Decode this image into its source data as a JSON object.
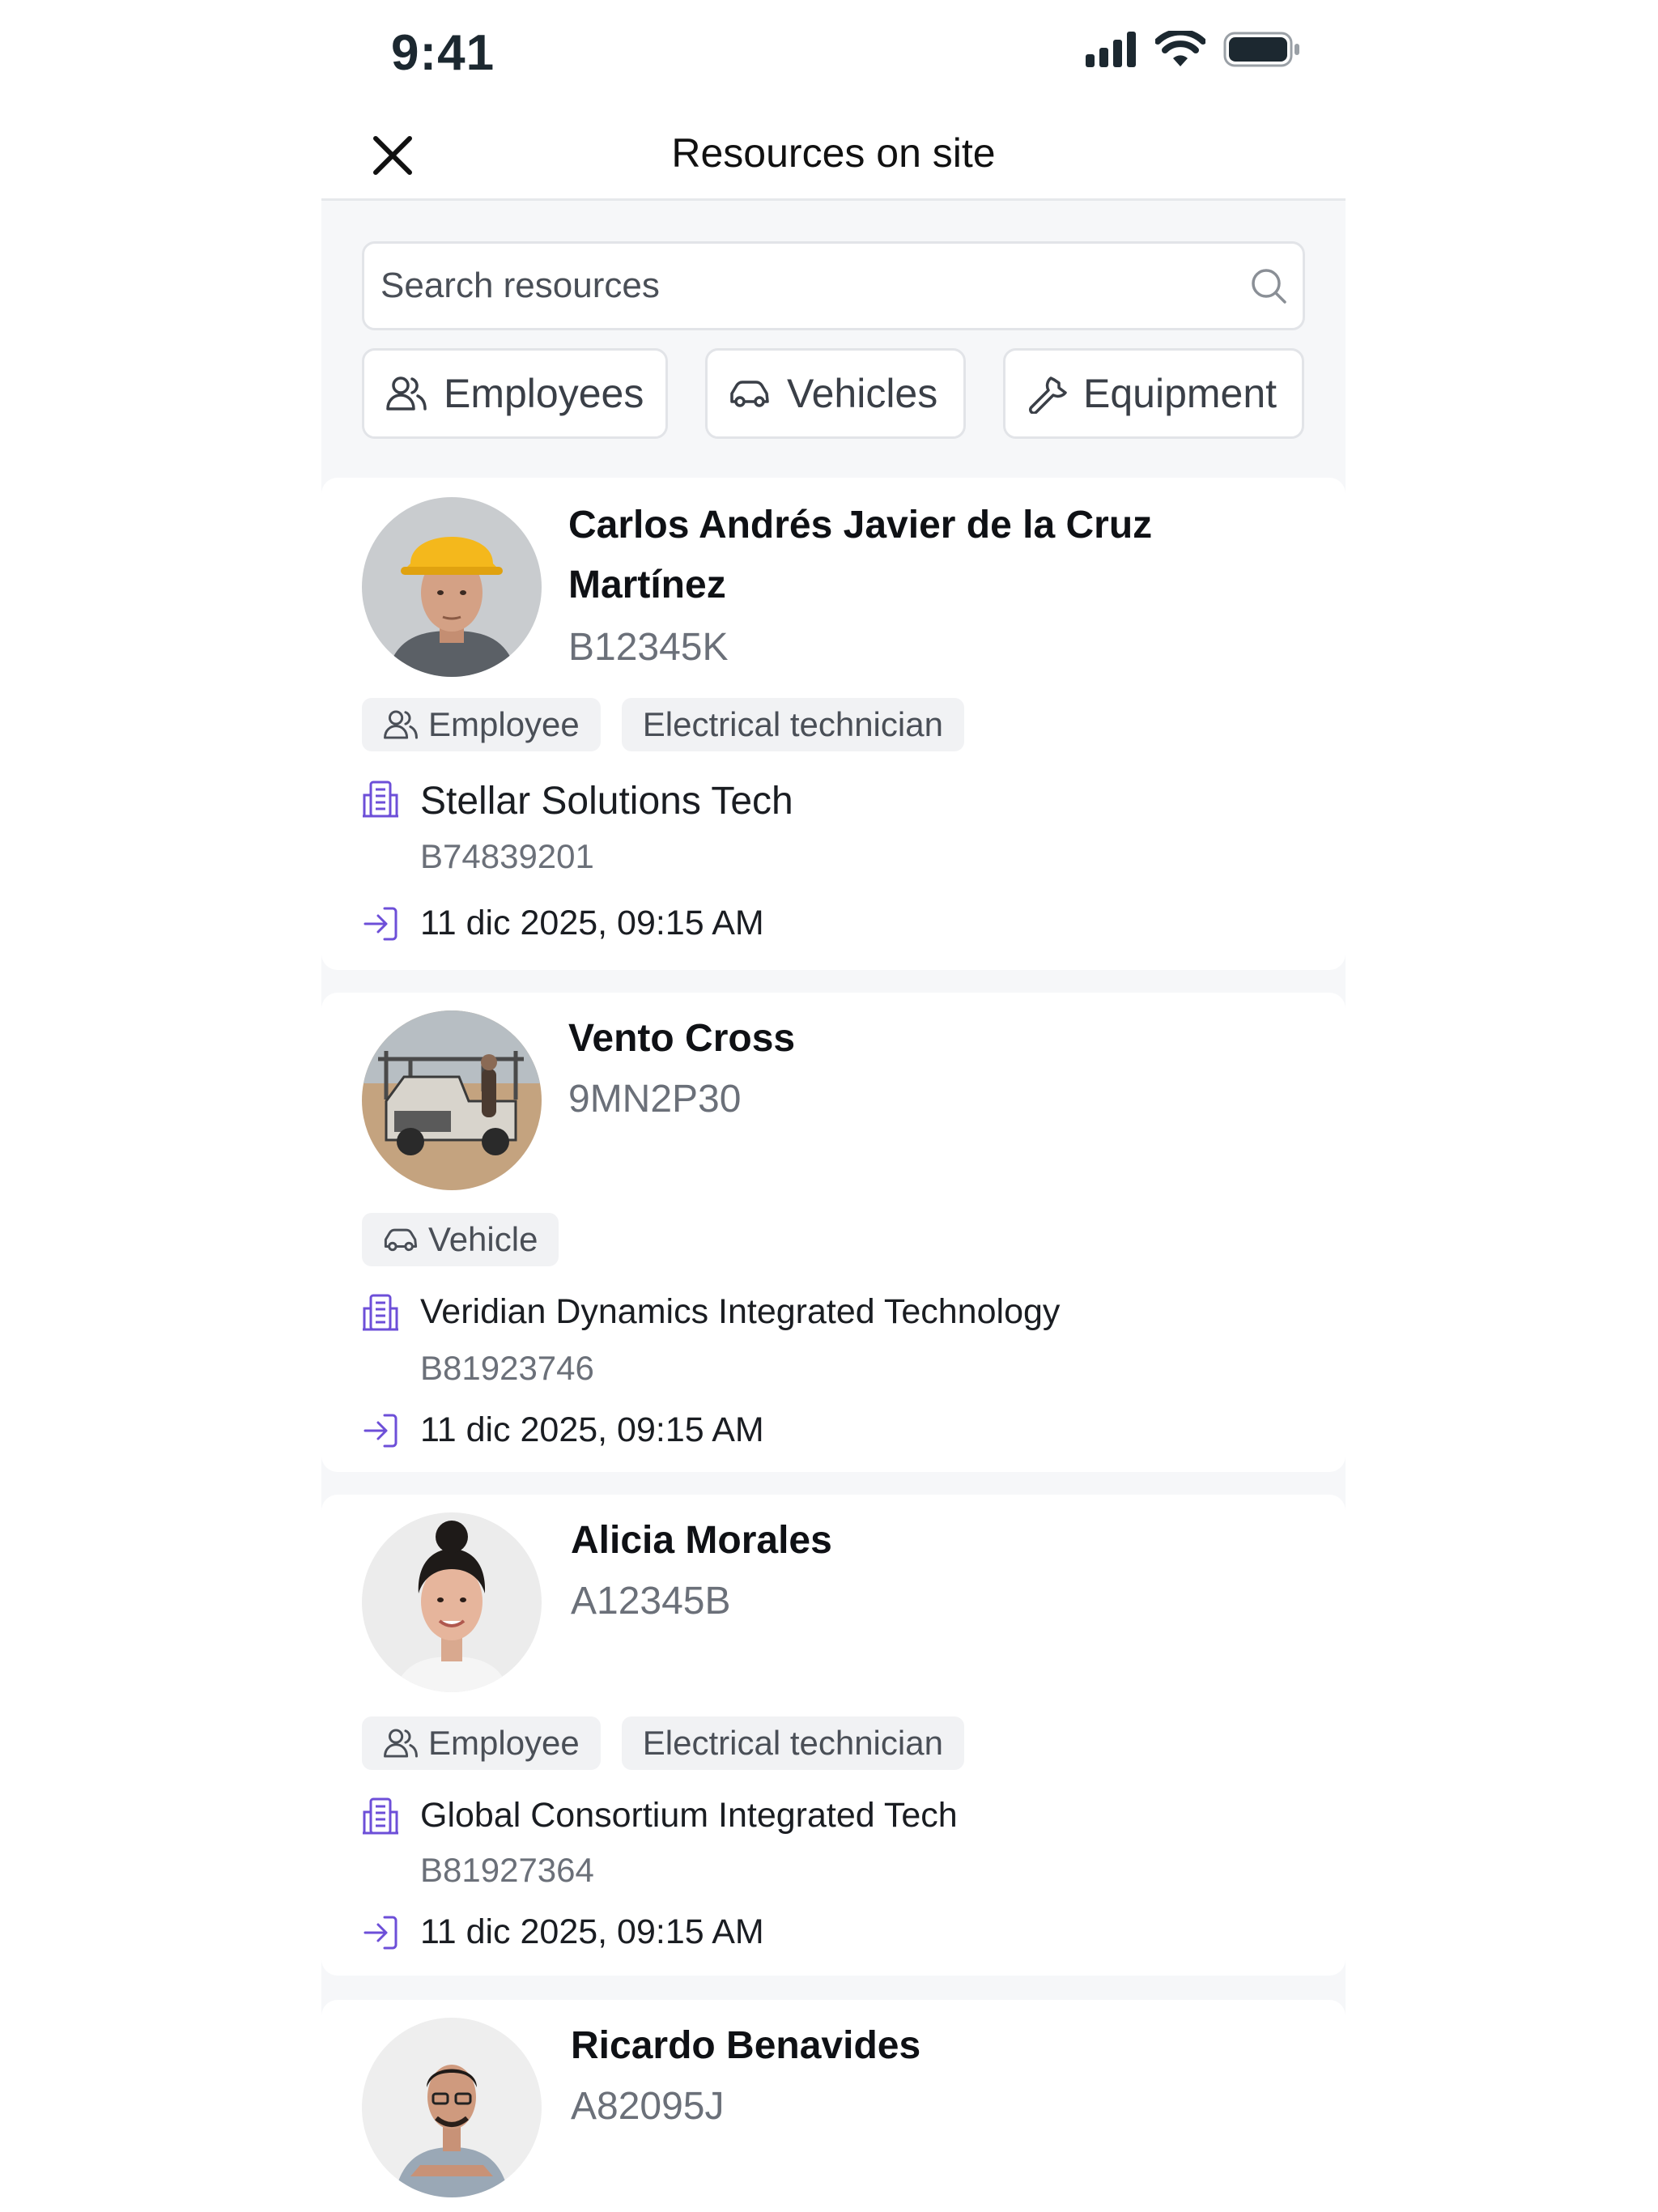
{
  "status_bar": {
    "time": "9:41"
  },
  "header": {
    "title": "Resources on site"
  },
  "search": {
    "placeholder": "Search resources"
  },
  "filters": [
    {
      "label": "Employees",
      "icon": "users-icon"
    },
    {
      "label": "Vehicles",
      "icon": "car-icon"
    },
    {
      "label": "Equipment",
      "icon": "wrench-icon"
    }
  ],
  "resources": [
    {
      "name": "Carlos Andrés Javier de la Cruz Martínez",
      "code": "B12345K",
      "type": "Employee",
      "role": "Electrical technician",
      "company": "Stellar Solutions Tech",
      "company_code": "B74839201",
      "entry": "11 dic 2025, 09:15 AM"
    },
    {
      "name": "Vento Cross",
      "code": "9MN2P30",
      "type": "Vehicle",
      "company": "Veridian Dynamics Integrated Technology",
      "company_code": "B81923746",
      "entry": "11 dic 2025, 09:15 AM"
    },
    {
      "name": "Alicia Morales",
      "code": "A12345B",
      "type": "Employee",
      "role": "Electrical technician",
      "company": "Global Consortium Integrated Tech",
      "company_code": "B81927364",
      "entry": "11 dic 2025, 09:15 AM"
    },
    {
      "name": "Ricardo Benavides",
      "code": "A82095J"
    }
  ],
  "colors": {
    "accent_icon": "#6d4fd8",
    "muted_text": "#6b7079"
  }
}
